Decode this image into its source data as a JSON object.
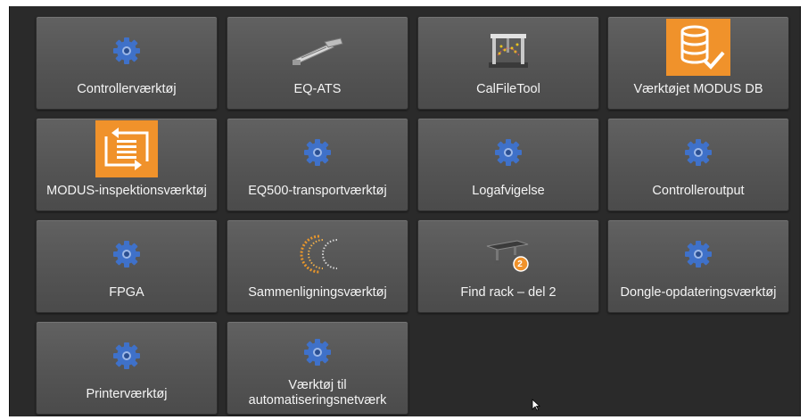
{
  "tiles": [
    {
      "label": "Controllerværktøj",
      "icon": "gear-icon"
    },
    {
      "label": "EQ-ATS",
      "icon": "probe-arm-icon"
    },
    {
      "label": "CalFileTool",
      "icon": "cmm-machine-icon"
    },
    {
      "label": "Værktøjet MODUS DB",
      "icon": "database-check-icon"
    },
    {
      "label": "MODUS-inspektionsværktøj",
      "icon": "modus-inspection-icon"
    },
    {
      "label": "EQ500-transportværktøj",
      "icon": "gear-icon"
    },
    {
      "label": "Logafvigelse",
      "icon": "gear-icon"
    },
    {
      "label": "Controlleroutput",
      "icon": "gear-icon"
    },
    {
      "label": "FPGA",
      "icon": "gear-icon"
    },
    {
      "label": "Sammenligningsværktøj",
      "icon": "compare-circles-icon"
    },
    {
      "label": "Find rack – del 2",
      "icon": "rack-badge-icon",
      "badge": "2"
    },
    {
      "label": "Dongle-opdateringsværktøj",
      "icon": "gear-icon"
    },
    {
      "label": "Printerværktøj",
      "icon": "gear-icon"
    },
    {
      "label": "Værktøj til\nautomatiseringsnetværk",
      "icon": "gear-icon"
    }
  ],
  "colors": {
    "accent_orange": "#f0922b",
    "gear_blue": "#3f71c9",
    "panel_bg": "#2a2a2a",
    "tile_bg": "#575757"
  }
}
